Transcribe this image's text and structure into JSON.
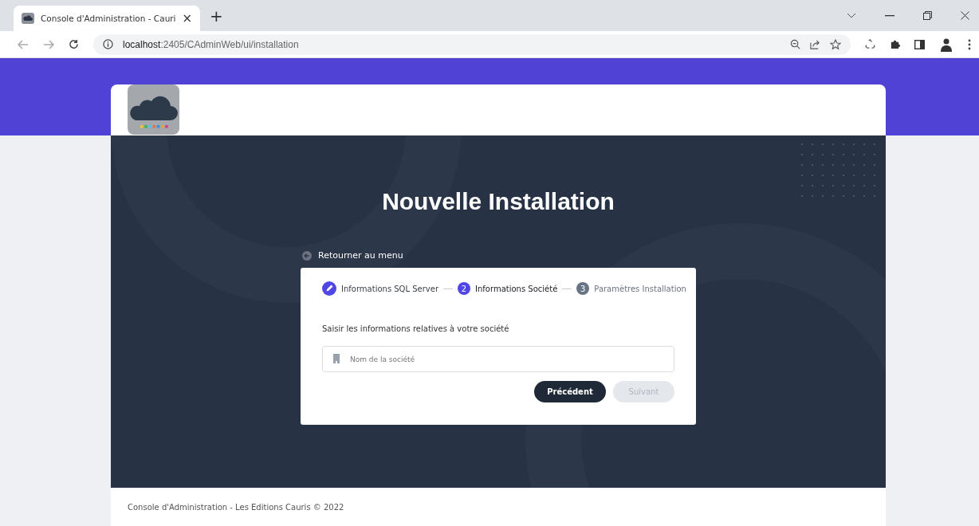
{
  "browser": {
    "tab_title": "Console d'Administration - Cauri",
    "tab_close": "×",
    "new_tab": "+",
    "url_host": "localhost",
    "url_path": ":2405/CAdminWeb/ui/installation"
  },
  "page": {
    "title": "Nouvelle Installation",
    "back_link": "Retourner au menu",
    "steps": [
      {
        "label": "Informations SQL Server",
        "completed": true,
        "selected": false
      },
      {
        "number": "2",
        "label": "Informations Société",
        "completed": false,
        "selected": true
      },
      {
        "number": "3",
        "label": "Paramètres Installation",
        "completed": false,
        "selected": false
      }
    ],
    "instruction": "Saisir les informations relatives à votre société",
    "company_field": {
      "placeholder": "Nom de la société"
    },
    "buttons": [
      {
        "label": "Précédent",
        "disabled": false
      },
      {
        "label": "Suivant",
        "disabled": true
      }
    ],
    "footer": "Console d'Administration - Les Editions Cauris © 2022"
  }
}
